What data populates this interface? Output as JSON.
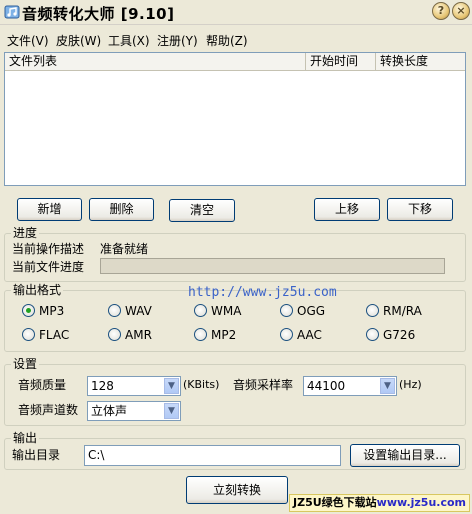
{
  "window": {
    "title": "音频转化大师 [9.10]",
    "minimize_glyph": "?",
    "close_glyph": "×"
  },
  "menu": [
    "文件(V)",
    "皮肤(W)",
    "工具(X)",
    "注册(Y)",
    "帮助(Z)"
  ],
  "file_list": {
    "columns": [
      "文件列表",
      "开始时间",
      "转换长度"
    ],
    "rows": []
  },
  "list_buttons": {
    "add": "新增",
    "delete": "删除",
    "clear": "清空",
    "move_up": "上移",
    "move_down": "下移"
  },
  "progress": {
    "group_label": "进度",
    "operation_label": "当前操作描述",
    "operation_value": "准备就绪",
    "file_progress_label": "当前文件进度",
    "file_progress_value": 0
  },
  "output_format": {
    "group_label": "输出格式",
    "options": [
      "MP3",
      "WAV",
      "WMA",
      "OGG",
      "RM/RA",
      "FLAC",
      "AMR",
      "MP2",
      "AAC",
      "G726"
    ],
    "selected": "MP3"
  },
  "watermark": "http://www.jz5u.com",
  "settings": {
    "group_label": "设置",
    "quality_label": "音频质量",
    "quality_value": "128",
    "quality_unit": "(KBits)",
    "sample_rate_label": "音频采样率",
    "sample_rate_value": "44100",
    "sample_rate_unit": "(Hz)",
    "channels_label": "音频声道数",
    "channels_value": "立体声"
  },
  "output": {
    "group_label": "输出",
    "dir_label": "输出目录",
    "dir_value": "C:\\",
    "set_dir_button": "设置输出目录..."
  },
  "convert_button": "立刻转换",
  "banner": {
    "part1": "JZ5U绿色下载站",
    "part2": "www.jz5u.com"
  },
  "colors": {
    "window_bg": "#ece9d8",
    "button_border": "#003c74",
    "radio_dot": "#21a121",
    "watermark": "#3b63c8"
  }
}
